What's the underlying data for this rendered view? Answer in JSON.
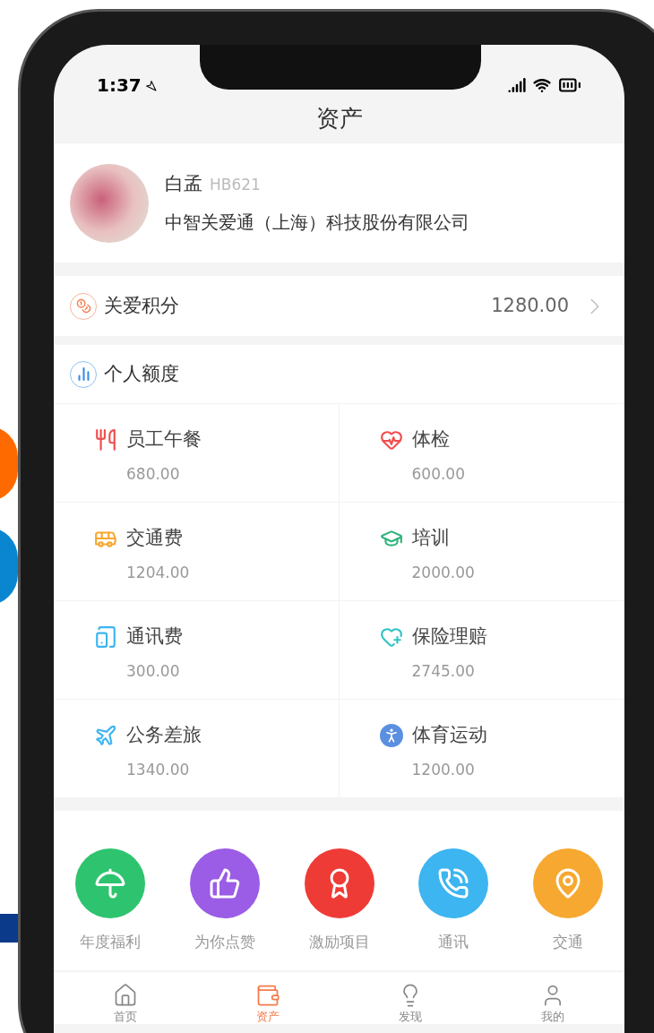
{
  "status_bar": {
    "time": "1:37"
  },
  "title": "资产",
  "profile": {
    "name": "白孟",
    "code": "HB621",
    "company": "中智关爱通（上海）科技股份有限公司"
  },
  "points": {
    "label": "关爱积分",
    "value": "1280.00"
  },
  "quota": {
    "title": "个人额度",
    "items": [
      {
        "kind": "meal",
        "label": "员工午餐",
        "amount": "680.00"
      },
      {
        "kind": "checkup",
        "label": "体检",
        "amount": "600.00"
      },
      {
        "kind": "transport",
        "label": "交通费",
        "amount": "1204.00"
      },
      {
        "kind": "training",
        "label": "培训",
        "amount": "2000.00"
      },
      {
        "kind": "phone",
        "label": "通讯费",
        "amount": "300.00"
      },
      {
        "kind": "insurance",
        "label": "保险理赔",
        "amount": "2745.00"
      },
      {
        "kind": "travel",
        "label": "公务差旅",
        "amount": "1340.00"
      },
      {
        "kind": "sports",
        "label": "体育运动",
        "amount": "1200.00"
      }
    ]
  },
  "shortcuts": [
    {
      "kind": "umbrella",
      "label": "年度福利",
      "color": "#2ec46f"
    },
    {
      "kind": "thumb",
      "label": "为你点赞",
      "color": "#9b5de5"
    },
    {
      "kind": "award",
      "label": "激励项目",
      "color": "#ef3b36"
    },
    {
      "kind": "call",
      "label": "通讯",
      "color": "#3db5f0"
    },
    {
      "kind": "pin",
      "label": "交通",
      "color": "#f6a830"
    }
  ],
  "tabs": [
    {
      "kind": "home",
      "label": "首页",
      "selected": false
    },
    {
      "kind": "wallet",
      "label": "资产",
      "selected": true
    },
    {
      "kind": "bulb",
      "label": "发现",
      "selected": false
    },
    {
      "kind": "user",
      "label": "我的",
      "selected": false
    }
  ]
}
